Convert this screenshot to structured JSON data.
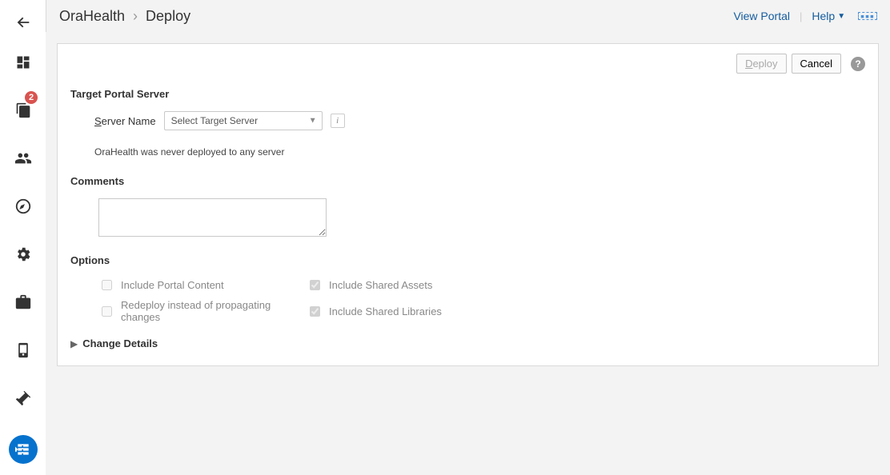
{
  "sidebar": {
    "badge_count": "2"
  },
  "header": {
    "portal_name": "OraHealth",
    "page_name": "Deploy",
    "view_portal": "View Portal",
    "help": "Help"
  },
  "toolbar": {
    "deploy_label": "Deploy",
    "cancel_label": "Cancel"
  },
  "target": {
    "section_title": "Target Portal Server",
    "server_label_pre": "S",
    "server_label_rest": "erver Name",
    "select_placeholder": "Select Target Server",
    "status_msg": "OraHealth was never deployed to any server"
  },
  "comments": {
    "section_title": "Comments",
    "value": ""
  },
  "options": {
    "section_title": "Options",
    "include_portal_content": "Include Portal Content",
    "include_shared_assets": "Include Shared Assets",
    "redeploy": "Redeploy instead of propagating changes",
    "include_shared_libraries": "Include Shared Libraries"
  },
  "change_details": {
    "label": "Change Details"
  }
}
